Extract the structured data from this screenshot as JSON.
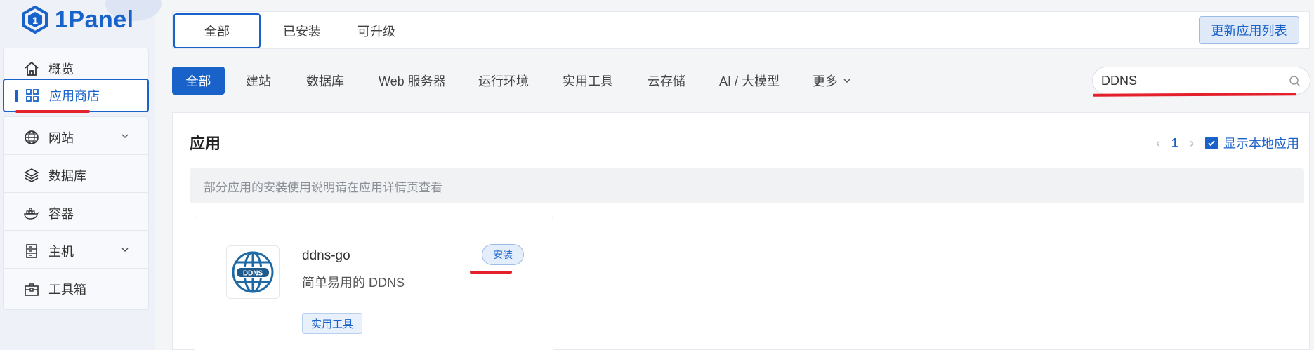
{
  "brand": {
    "logo_text": "1Panel",
    "accent_color": "#1862c9",
    "highlight_color": "#e3202b"
  },
  "sidebar": {
    "items": [
      {
        "label": "概览",
        "icon": "home-icon"
      },
      {
        "label": "应用商店",
        "icon": "grid-icon",
        "active": true
      },
      {
        "label": "网站",
        "icon": "globe-icon",
        "has_submenu": true
      },
      {
        "label": "数据库",
        "icon": "layers-icon"
      },
      {
        "label": "容器",
        "icon": "docker-icon"
      },
      {
        "label": "主机",
        "icon": "server-icon",
        "has_submenu": true
      },
      {
        "label": "工具箱",
        "icon": "toolbox-icon"
      }
    ]
  },
  "top_tabs": {
    "items": [
      "全部",
      "已安装",
      "可升级"
    ],
    "active": "全部",
    "update_button": "更新应用列表"
  },
  "categories": {
    "items": [
      "全部",
      "建站",
      "数据库",
      "Web 服务器",
      "运行环境",
      "实用工具",
      "云存储",
      "AI / 大模型",
      "更多"
    ],
    "active": "全部"
  },
  "search": {
    "value": "DDNS"
  },
  "apps_section": {
    "title": "应用",
    "page": "1",
    "show_local_label": "显示本地应用",
    "show_local_checked": true,
    "notice": "部分应用的安装使用说明请在应用详情页查看"
  },
  "app_card": {
    "name": "ddns-go",
    "description": "简单易用的 DDNS",
    "icon_text": "DDNS",
    "install_label": "安装",
    "tag": "实用工具"
  }
}
